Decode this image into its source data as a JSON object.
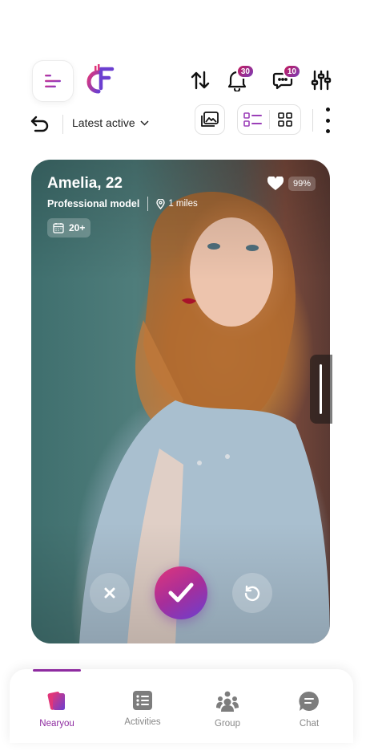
{
  "header": {
    "menu_icon": "menu-lines-icon",
    "logo_icon": "brand-logo-icon",
    "logo_text": "CF",
    "sort_icon": "sort-updown-icon",
    "notifications": {
      "icon": "bell-icon",
      "count": "30"
    },
    "messages": {
      "icon": "chat-bubble-icon",
      "count": "10"
    },
    "filter_icon": "sliders-icon"
  },
  "toolbar": {
    "back_icon": "undo-arrow-icon",
    "sort_label": "Latest active",
    "gallery_icon": "gallery-icon",
    "view_list_icon": "list-view-icon",
    "view_grid_icon": "grid-view-icon",
    "more_icon": "more-vertical-icon"
  },
  "profile": {
    "name": "Amelia, 22",
    "occupation": "Professional model",
    "distance": "1 miles",
    "age_range": "20+",
    "match_percent": "99%"
  },
  "actions": {
    "reject_icon": "close-icon",
    "accept_icon": "check-icon",
    "rewind_icon": "rewind-icon"
  },
  "bottom_nav": {
    "active": "Nearyou",
    "items": [
      {
        "label": "Nearyou",
        "icon": "cards-icon"
      },
      {
        "label": "Activities",
        "icon": "list-icon"
      },
      {
        "label": "Group",
        "icon": "group-icon"
      },
      {
        "label": "Chat",
        "icon": "chat-icon"
      }
    ]
  },
  "colors": {
    "accent": "#8e2ba0",
    "accent_pink": "#e0367a",
    "accent_violet": "#6b3fd0"
  }
}
